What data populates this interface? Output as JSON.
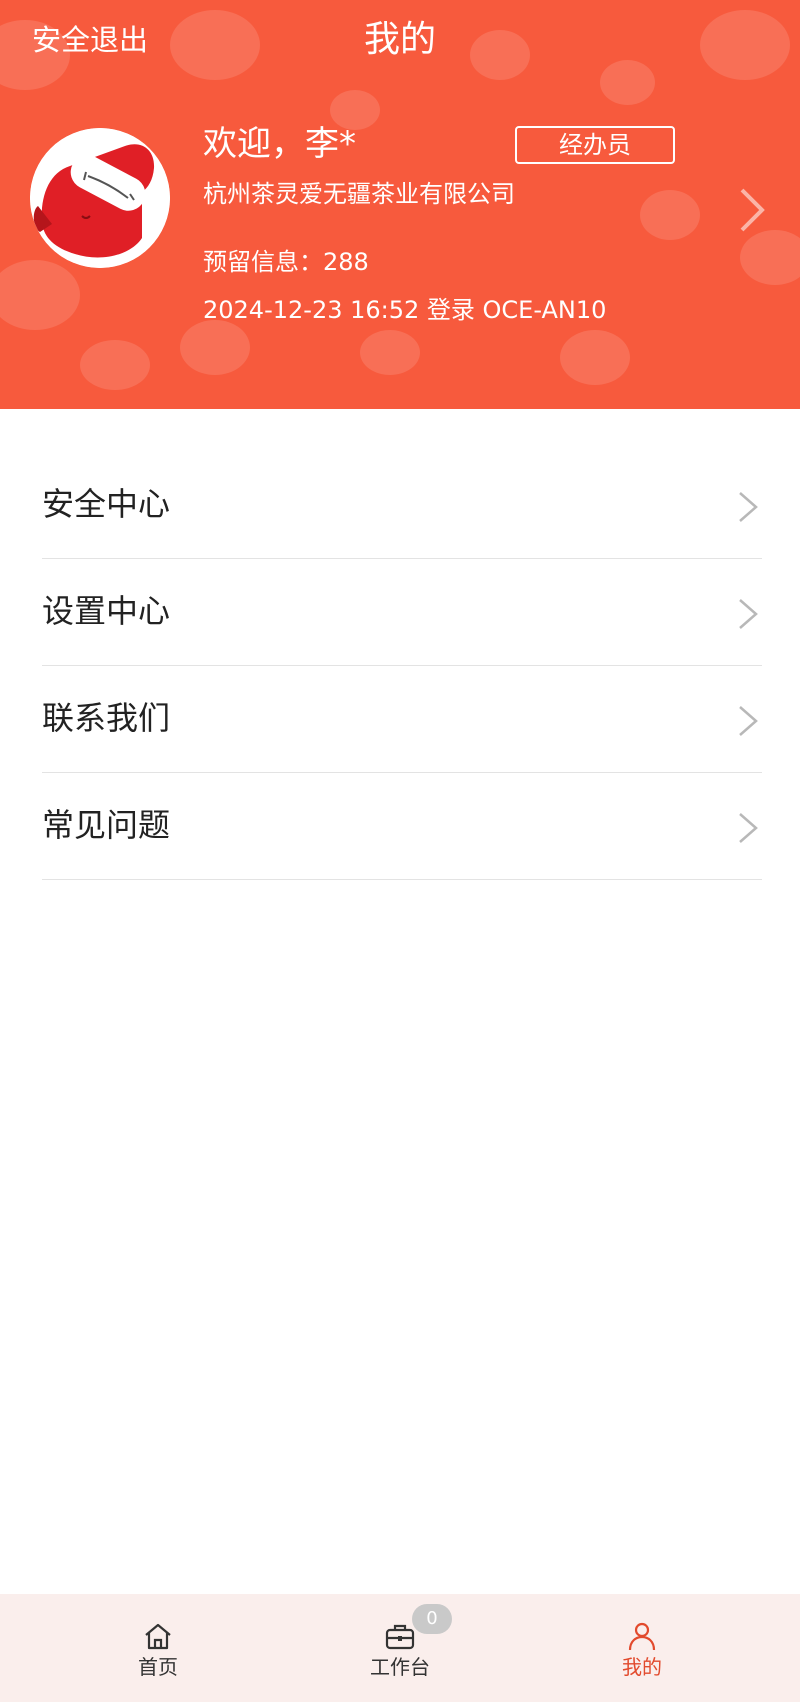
{
  "header": {
    "logout_label": "安全退出",
    "title": "我的"
  },
  "profile": {
    "welcome": "欢迎，李*",
    "role": "经办员",
    "company": "杭州茶灵爱无疆茶业有限公司",
    "reserved_info": "预留信息：288",
    "login_info": "2024-12-23 16:52 登录 OCE-AN10"
  },
  "menu": {
    "items": [
      {
        "label": "安全中心"
      },
      {
        "label": "设置中心"
      },
      {
        "label": "联系我们"
      },
      {
        "label": "常见问题"
      }
    ]
  },
  "tabbar": {
    "home_label": "首页",
    "workbench_label": "工作台",
    "workbench_badge": "0",
    "mine_label": "我的",
    "active_color": "#e24a2d"
  },
  "colors": {
    "header_bg": "#f75a3d",
    "tabbar_bg": "#faeeec"
  }
}
